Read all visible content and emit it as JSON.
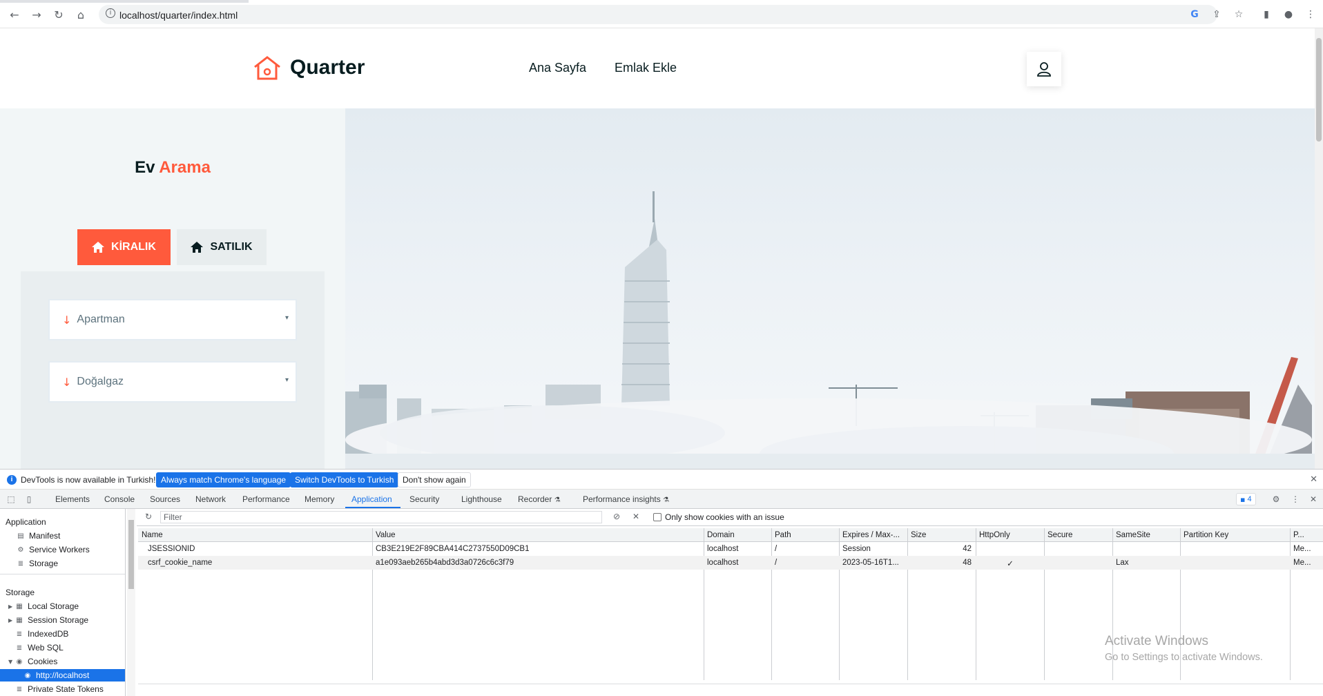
{
  "browser": {
    "url": "localhost/quarter/index.html"
  },
  "site": {
    "logo_text": "Quarter",
    "nav": [
      "Ana Sayfa",
      "Emlak Ekle"
    ],
    "search_title_prefix": "Ev",
    "search_title_accent": "Arama",
    "tabs": [
      "KİRALIK",
      "SATILIK"
    ],
    "selects": [
      "Apartman",
      "Doğalgaz"
    ],
    "accent_color": "#ff5a3c"
  },
  "devtools": {
    "infobar": {
      "message": "DevTools is now available in Turkish!",
      "btn_match": "Always match Chrome's language",
      "btn_switch": "Switch DevTools to Turkish",
      "btn_dismiss": "Don't show again"
    },
    "tabs": [
      "Elements",
      "Console",
      "Sources",
      "Network",
      "Performance",
      "Memory",
      "Application",
      "Security",
      "Lighthouse",
      "Recorder",
      "Performance insights"
    ],
    "active_tab": "Application",
    "issue_count": "4",
    "sidebar": {
      "application_heading": "Application",
      "application_items": [
        "Manifest",
        "Service Workers",
        "Storage"
      ],
      "storage_heading": "Storage",
      "storage_items": [
        "Local Storage",
        "Session Storage",
        "IndexedDB",
        "Web SQL",
        "Cookies",
        "http://localhost",
        "Private State Tokens"
      ]
    },
    "cookies": {
      "filter_placeholder": "Filter",
      "only_issue_label": "Only show cookies with an issue",
      "columns": [
        "Name",
        "Value",
        "Domain",
        "Path",
        "Expires / Max-...",
        "Size",
        "HttpOnly",
        "Secure",
        "SameSite",
        "Partition Key",
        "P..."
      ],
      "rows": [
        {
          "name": "JSESSIONID",
          "value": "CB3E219E2F89CBA414C2737550D09CB1",
          "domain": "localhost",
          "path": "/",
          "expires": "Session",
          "size": "42",
          "httponly": "",
          "secure": "",
          "samesite": "",
          "partition": "",
          "p": "Me..."
        },
        {
          "name": "csrf_cookie_name",
          "value": "a1e093aeb265b4abd3d3a0726c6c3f79",
          "domain": "localhost",
          "path": "/",
          "expires": "2023-05-16T1...",
          "size": "48",
          "httponly": "✓",
          "secure": "",
          "samesite": "Lax",
          "partition": "",
          "p": "Me..."
        }
      ]
    }
  },
  "watermark": {
    "line1": "Activate Windows",
    "line2": "Go to Settings to activate Windows."
  }
}
